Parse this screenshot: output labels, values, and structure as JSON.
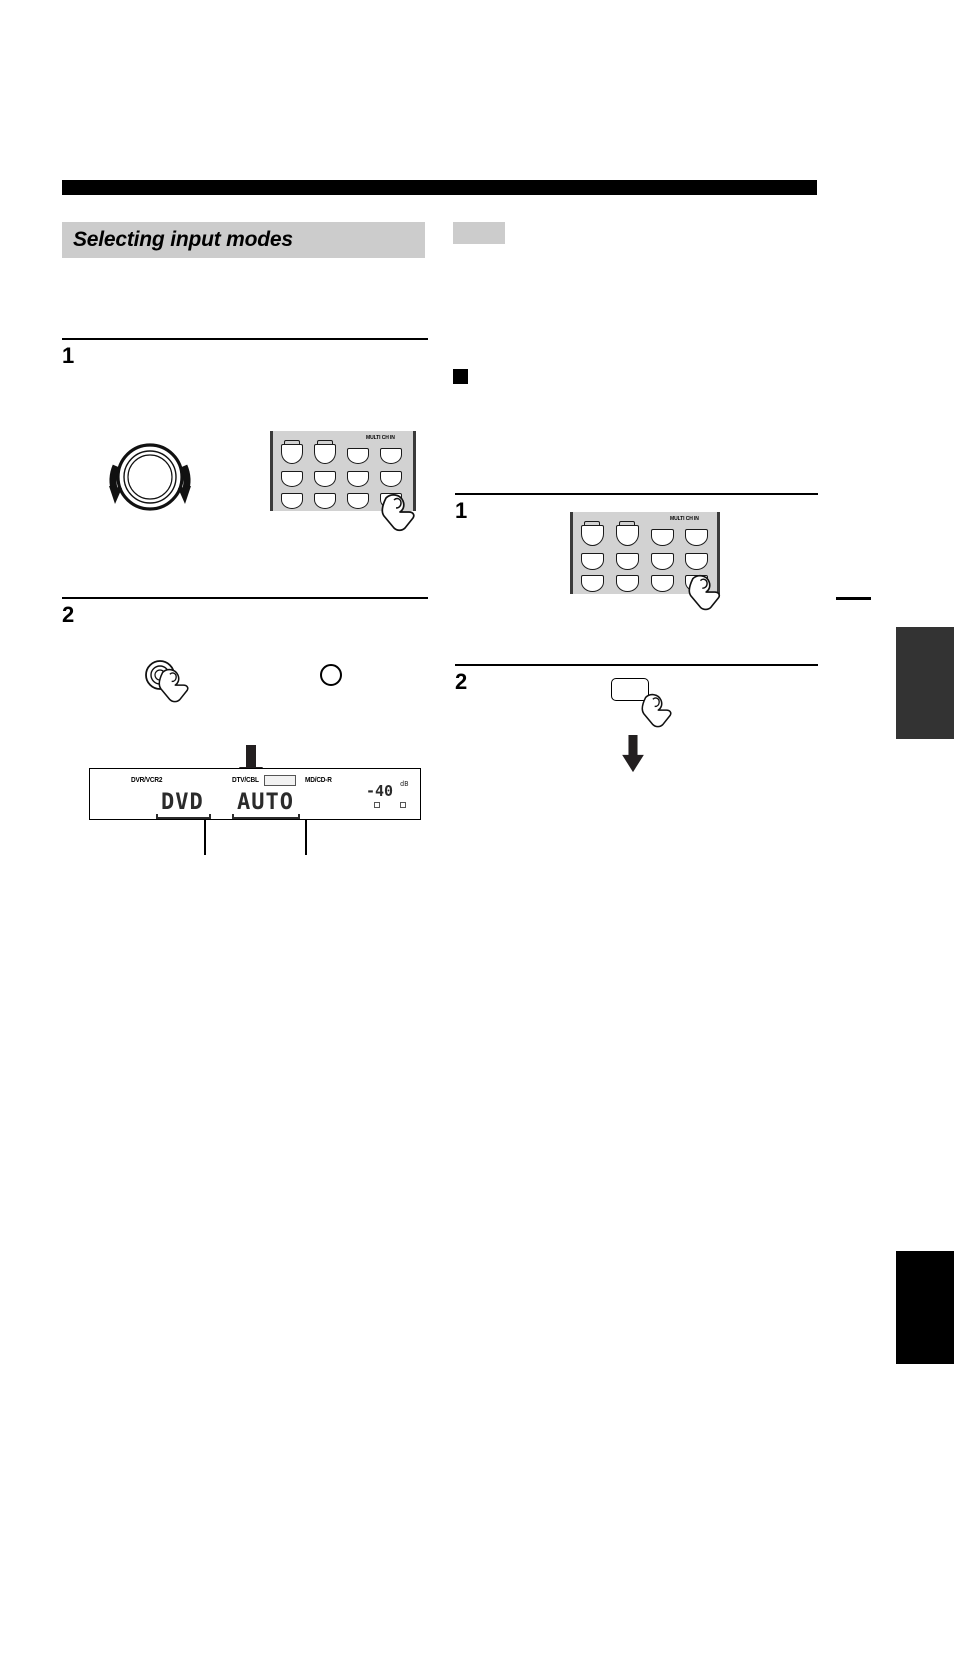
{
  "page": {
    "background_color": "#ffffff",
    "section_heading": "Selecting input modes"
  },
  "left_column": {
    "steps": [
      {
        "number": "1"
      },
      {
        "number": "2"
      }
    ],
    "knob_illustration": {
      "icon": "rotary-knob-icon",
      "rotation_hint": "bidirectional-rotation-arrows"
    },
    "keypad_illustration": {
      "icon": "remote-keypad-icon",
      "panel_color": "#d2d2d2",
      "multi_ch_in_label": "MULTI CH IN",
      "rows": 3,
      "columns": 4,
      "pressed_key": "bottom-right"
    },
    "button_illustration": {
      "icon": "round-button-press-icon",
      "second_icon": "plain-circle-icon"
    },
    "flow_arrow": "down-arrow-icon",
    "display_panel": {
      "top_indicators": [
        "DVR/VCR2",
        "DTV/CBL",
        "MD/CD-R"
      ],
      "input_text": "DVD",
      "mode_text": "AUTO",
      "volume_value": "-40",
      "volume_unit": "dB",
      "led_indicators": 2,
      "callouts": 2
    }
  },
  "right_column": {
    "note_chip": "",
    "bullet_heading": "",
    "steps": [
      {
        "number": "1"
      },
      {
        "number": "2"
      }
    ],
    "keypad_illustration": {
      "icon": "remote-keypad-icon",
      "panel_color": "#d2d2d2",
      "multi_ch_in_label": "MULTI CH IN",
      "rows": 3,
      "columns": 4,
      "pressed_key": "bottom-right"
    },
    "button_illustration": {
      "icon": "rounded-rect-button-press-icon"
    },
    "flow_arrow": "down-arrow-icon"
  },
  "edge_tabs": [
    {
      "name": "upper",
      "color": "#333333"
    },
    {
      "name": "lower",
      "color": "#000000"
    }
  ]
}
